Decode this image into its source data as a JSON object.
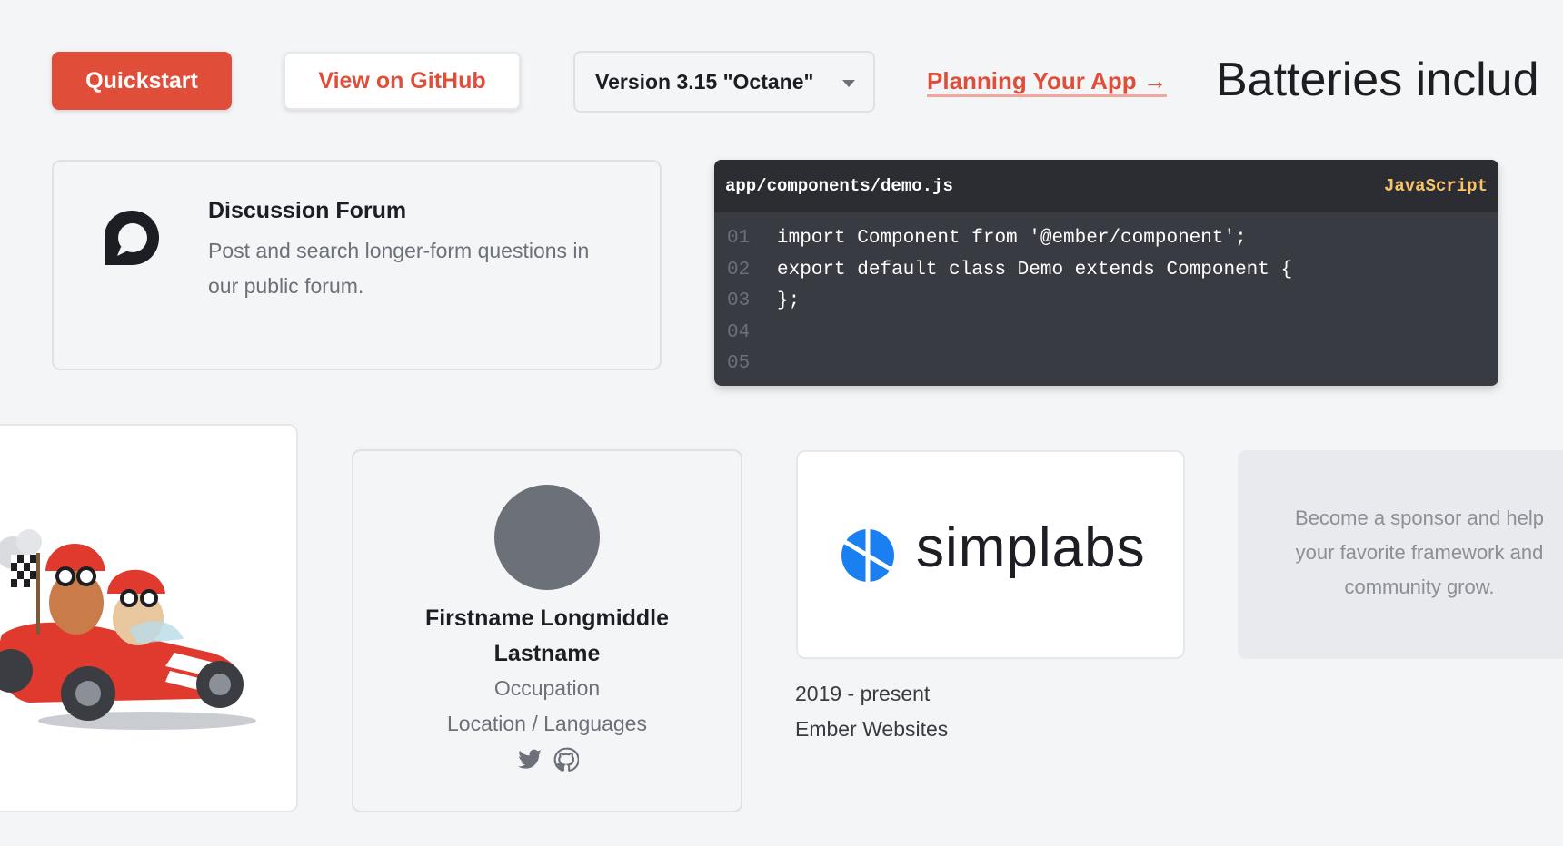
{
  "buttons": {
    "quickstart": "Quickstart",
    "github": "View on GitHub"
  },
  "version_select": {
    "selected": "Version 3.15 \"Octane\""
  },
  "planning_link": "Planning Your App →",
  "heading_partial": "Batteries includ",
  "forum_card": {
    "title": "Discussion Forum",
    "description": "Post and search longer-form questions in our public forum."
  },
  "code_block": {
    "filename": "app/components/demo.js",
    "language": "JavaScript",
    "lines": [
      {
        "num": "01",
        "code": "import Component from '@ember/component';"
      },
      {
        "num": "02",
        "code": "export default class Demo extends Component {"
      },
      {
        "num": "03",
        "code": "};"
      },
      {
        "num": "04",
        "code": ""
      },
      {
        "num": "05",
        "code": ""
      }
    ]
  },
  "person_card": {
    "name": "Firstname Longmiddle Lastname",
    "occupation": "Occupation",
    "location": "Location / Languages"
  },
  "sponsor": {
    "logo_text": "simplabs",
    "years": "2019 - present",
    "project": "Ember Websites"
  },
  "become_sponsor": {
    "line1": "Become a sponsor and help",
    "line2": "your favorite framework and",
    "line3": "community grow."
  },
  "colors": {
    "brand": "#e04e39",
    "background": "#f4f5f7",
    "code_bg": "#393b42",
    "simplabs_blue": "#1a7ff0"
  }
}
